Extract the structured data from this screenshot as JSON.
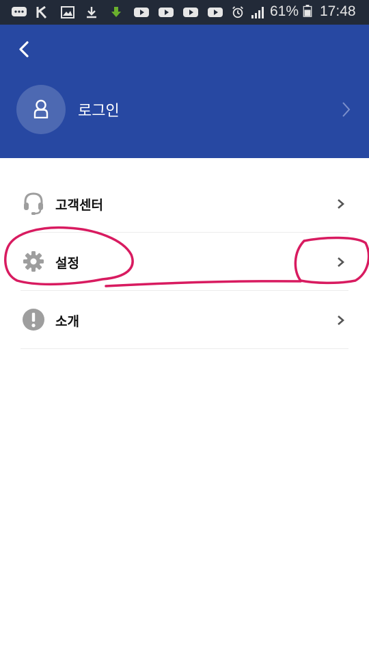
{
  "status_bar": {
    "battery": "61%",
    "time": "17:48",
    "icons": [
      "chat-icon",
      "k-icon",
      "image-icon",
      "download-icon",
      "green-download-icon",
      "youtube-icon",
      "youtube-icon",
      "youtube-icon",
      "youtube-icon",
      "alarm-icon",
      "signal-icon",
      "battery-icon"
    ]
  },
  "header": {
    "back_icon": "chevron-left-icon",
    "avatar_icon": "person-icon",
    "login_label": "로그인",
    "login_arrow_icon": "chevron-right-icon",
    "background_color": "#2748a2"
  },
  "menu": {
    "items": [
      {
        "label": "고객센터",
        "icon": "headset-icon"
      },
      {
        "label": "설정",
        "icon": "gear-icon"
      },
      {
        "label": "소개",
        "icon": "info-icon"
      }
    ]
  },
  "annotation": {
    "color": "#d81b60"
  }
}
